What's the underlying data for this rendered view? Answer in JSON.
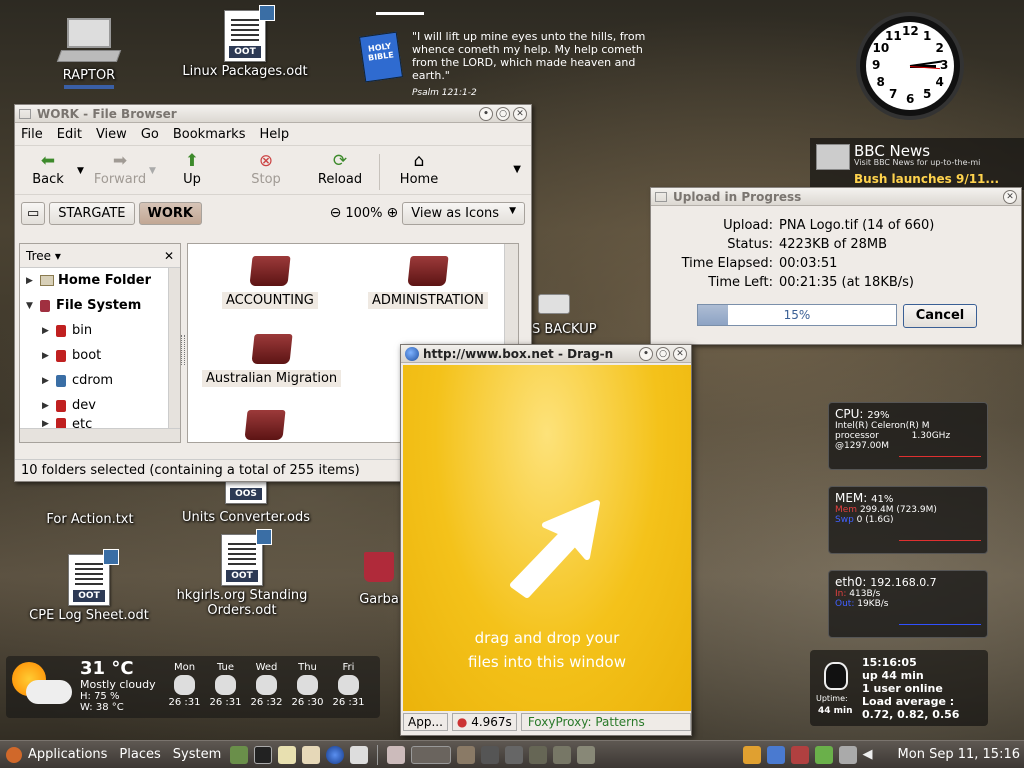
{
  "desktop": {
    "icons": [
      {
        "label": "RAPTOR"
      },
      {
        "label": "Linux Packages.odt",
        "tag": "OOT"
      },
      {
        "label": "For Action.txt"
      },
      {
        "label": "Units Converter.ods",
        "tag": "OOS"
      },
      {
        "label": "CPE Log Sheet.odt",
        "tag": "OOT"
      },
      {
        "label": "hkgirls.org Standing",
        "label2": "Orders.odt",
        "tag": "OOT"
      },
      {
        "label": "Garba"
      },
      {
        "label": "S BACKUP"
      }
    ]
  },
  "bible": {
    "verse": "\"I will lift up mine eyes unto the hills, from whence cometh my help. My help cometh from the LORD, which made heaven and earth.\"",
    "reference": "Psalm 121:1-2",
    "book_label": "HOLY BIBLE"
  },
  "clock": {
    "numbers": [
      "12",
      "1",
      "2",
      "3",
      "4",
      "5",
      "6",
      "7",
      "8",
      "9",
      "10",
      "11"
    ]
  },
  "bbc": {
    "title": "BBC News",
    "sub": "Visit BBC News for up-to-the-mi",
    "headline": "Bush launches 9/11..."
  },
  "file_browser": {
    "title": "WORK - File Browser",
    "menu": [
      "File",
      "Edit",
      "View",
      "Go",
      "Bookmarks",
      "Help"
    ],
    "toolbar": {
      "back": "Back",
      "forward": "Forward",
      "up": "Up",
      "stop": "Stop",
      "reload": "Reload",
      "home": "Home"
    },
    "path": [
      "STARGATE",
      "WORK"
    ],
    "zoom": "100%",
    "view_mode": "View as Icons",
    "sidebar_mode": "Tree",
    "tree": [
      {
        "label": "Home Folder",
        "bold": true
      },
      {
        "label": "File System",
        "bold": true
      },
      {
        "label": "bin"
      },
      {
        "label": "boot"
      },
      {
        "label": "cdrom"
      },
      {
        "label": "dev"
      },
      {
        "label": "etc"
      }
    ],
    "folders": [
      "ACCOUNTING",
      "ADMINISTRATION",
      "Australian Migration"
    ],
    "status": "10 folders selected (containing a total of 255 items)"
  },
  "upload": {
    "title": "Upload in Progress",
    "rows": [
      {
        "k": "Upload:",
        "v": "PNA Logo.tif (14 of 660)"
      },
      {
        "k": "Status:",
        "v": "4223KB of 28MB"
      },
      {
        "k": "Time Elapsed:",
        "v": "00:03:51"
      },
      {
        "k": "Time Left:",
        "v": "00:21:35 (at 18KB/s)"
      }
    ],
    "progress_percent": 15,
    "progress_label": "15%",
    "cancel": "Cancel"
  },
  "boxnet": {
    "title": "http://www.box.net - Drag-n",
    "drop_line1": "drag and drop your",
    "drop_line2": "files into this window",
    "status_app": "App...",
    "status_time": "4.967s",
    "status_proxy": "FoxyProxy: Patterns"
  },
  "monitors": {
    "cpu": {
      "label": "CPU:",
      "pct": "29%",
      "l1": "Intel(R) Celeron(R) M",
      "l2": "processor",
      "l3": "1.30GHz",
      "l4": "@1297.00M"
    },
    "mem": {
      "label": "MEM:",
      "pct": "41%",
      "l1": "Mem",
      "l1v": "299.4M (723.9M)",
      "l2": "Swp",
      "l2v": "0 (1.6G)"
    },
    "net": {
      "label": "eth0:",
      "ip": "192.168.0.7",
      "in_label": "In:",
      "in_v": "413B/s",
      "out_label": "Out:",
      "out_v": "19KB/s"
    },
    "uptime": {
      "time": "15:16:05",
      "up": "up 44 min",
      "users": "1 user online",
      "load_label": "Load average :",
      "load": "0.72, 0.82, 0.56",
      "mini_label": "Uptime:",
      "mini_val": "44 min"
    }
  },
  "weather": {
    "temp": "31 °C",
    "cond": "Mostly cloudy",
    "humidity": "H: 75 %",
    "wind": "W: 38 °C",
    "days": [
      {
        "d": "Mon",
        "r": "26 :31"
      },
      {
        "d": "Tue",
        "r": "26 :31"
      },
      {
        "d": "Wed",
        "r": "26 :32"
      },
      {
        "d": "Thu",
        "r": "26 :30"
      },
      {
        "d": "Fri",
        "r": "26 :31"
      }
    ]
  },
  "panel": {
    "menus": [
      "Applications",
      "Places",
      "System"
    ],
    "datetime": "Mon Sep 11, 15:16"
  }
}
